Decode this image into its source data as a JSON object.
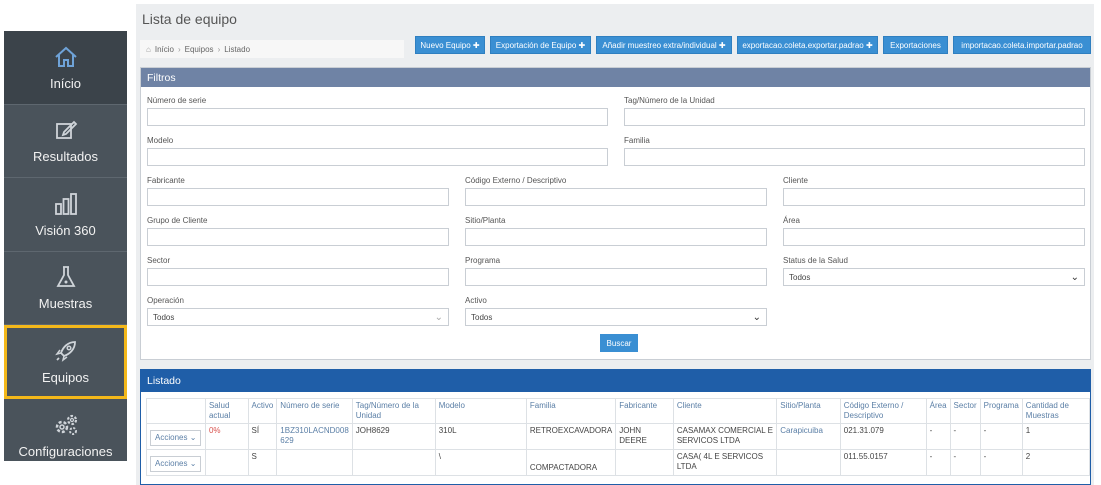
{
  "sidebar": {
    "items": [
      {
        "label": "Início",
        "icon": "home-icon"
      },
      {
        "label": "Resultados",
        "icon": "edit-icon"
      },
      {
        "label": "Visión 360",
        "icon": "bar-chart-icon"
      },
      {
        "label": "Muestras",
        "icon": "flask-icon"
      },
      {
        "label": "Equipos",
        "icon": "rocket-icon"
      },
      {
        "label": "Configuraciones",
        "icon": "gears-icon"
      }
    ],
    "highlight_color": "#f4b81a"
  },
  "header": {
    "title": "Lista de equipo",
    "breadcrumb": [
      "Início",
      "Equipos",
      "Listado"
    ]
  },
  "toolbar": {
    "nuevo": "Nuevo Equipo",
    "exportacion": "Exportación de Equipo",
    "anadir": "Añadir muestreo extra/individual",
    "exportacao": "exportacao.coleta.exportar.padrao",
    "exportaciones": "Exportaciones",
    "importacao": "importacao.coleta.importar.padrao"
  },
  "filters": {
    "title": "Filtros",
    "numero_serie": "Número de serie",
    "tag": "Tag/Número de la Unidad",
    "modelo": "Modelo",
    "familia": "Familia",
    "fabricante": "Fabricante",
    "codigo": "Código Externo / Descriptivo",
    "cliente": "Cliente",
    "grupo": "Grupo de Cliente",
    "sitio": "Sitio/Planta",
    "area": "Área",
    "sector": "Sector",
    "programa": "Programa",
    "status": "Status de la Salud",
    "status_value": "Todos",
    "operacion": "Operación",
    "operacion_value": "Todos",
    "activo": "Activo",
    "activo_value": "Todos",
    "buscar": "Buscar"
  },
  "listing": {
    "title": "Listado",
    "columns": [
      "",
      "Salud actual",
      "Activo",
      "Número de serie",
      "Tag/Número de la Unidad",
      "Modelo",
      "Familia",
      "Fabricante",
      "Cliente",
      "Sitio/Planta",
      "Código Externo / Descriptivo",
      "Área",
      "Sector",
      "Programa",
      "Cantidad de Muestras"
    ],
    "action_label": "Acciones",
    "rows": [
      {
        "salud": "0%",
        "activo": "SÍ",
        "serie": "1BZ310LACND008 629",
        "tag": "JOH8629",
        "modelo": "310L",
        "familia": "RETROEXCAVADORA",
        "fabricante": "JOHN DEERE",
        "cliente": "CASAMAX COMERCIAL E SERVICOS LTDA",
        "sitio": "Carapicuiba",
        "codigo": "021.31.079",
        "area": "-",
        "sector": "-",
        "programa": "-",
        "cantidad": "1"
      },
      {
        "salud": "",
        "activo": "S",
        "serie": "",
        "tag": "",
        "modelo": "\\",
        "familia": "COMPACTADORA",
        "fabricante": "",
        "cliente": "CASA( 4L E SERVICOS LTDA",
        "sitio": "",
        "codigo": "011.55.0157",
        "area": "-",
        "sector": "-",
        "programa": "-",
        "cantidad": "2"
      }
    ]
  }
}
